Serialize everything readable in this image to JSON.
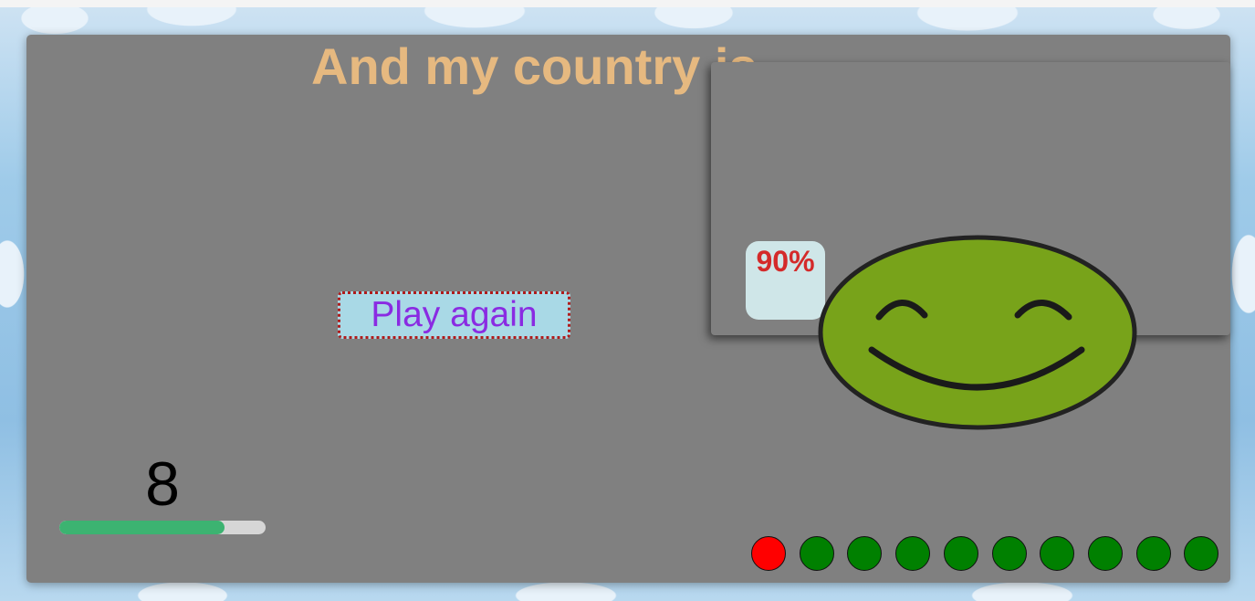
{
  "title": "And my country is...",
  "result": {
    "percent": "90%",
    "mood": "happy"
  },
  "play_again_label": "Play again",
  "score": "8",
  "progress": {
    "fraction": 0.8,
    "color": "#3cb371"
  },
  "rounds": [
    {
      "status": "wrong",
      "color": "#ff0000"
    },
    {
      "status": "correct",
      "color": "#008000"
    },
    {
      "status": "correct",
      "color": "#008000"
    },
    {
      "status": "correct",
      "color": "#008000"
    },
    {
      "status": "correct",
      "color": "#008000"
    },
    {
      "status": "correct",
      "color": "#008000"
    },
    {
      "status": "correct",
      "color": "#008000"
    },
    {
      "status": "correct",
      "color": "#008000"
    },
    {
      "status": "correct",
      "color": "#008000"
    },
    {
      "status": "correct",
      "color": "#008000"
    }
  ],
  "colors": {
    "panel": "#808080",
    "title": "#e6b980",
    "percent_text": "#d42a2a",
    "button_text": "#8a2be2",
    "smiley_face": "#78a31a"
  }
}
